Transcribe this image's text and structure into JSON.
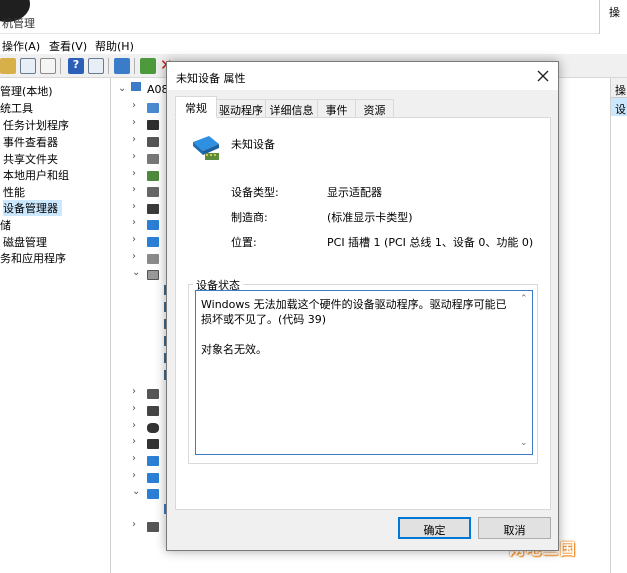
{
  "background_window": {
    "title": "机管理",
    "right_title": "操",
    "menu": [
      "操作(A)",
      "查看(V)",
      "帮助(H)"
    ],
    "left_tree": [
      "管理(本地)",
      "统工具",
      "任务计划程序",
      "事件查看器",
      "共享文件夹",
      "本地用户和组",
      "性能",
      "设备管理器",
      "储",
      "磁盘管理",
      "务和应用程序"
    ],
    "tree_root": "A08",
    "right_pane": {
      "header": "操",
      "selected": "设"
    },
    "watermark": "网吧三国"
  },
  "dialog": {
    "title": "未知设备 属性",
    "tabs": [
      "常规",
      "驱动程序",
      "详细信息",
      "事件",
      "资源"
    ],
    "device_name": "未知设备",
    "properties": [
      {
        "label": "设备类型:",
        "value": "显示适配器"
      },
      {
        "label": "制造商:",
        "value": "(标准显示卡类型)"
      },
      {
        "label": "位置:",
        "value": "PCI 插槽 1 (PCI 总线 1、设备 0、功能 0)"
      }
    ],
    "status_group_title": "设备状态",
    "status_text": "Windows 无法加载这个硬件的设备驱动程序。驱动程序可能已损坏或不见了。(代码 39)\n\n对象名无效。",
    "ok_label": "确定",
    "cancel_label": "取消"
  }
}
